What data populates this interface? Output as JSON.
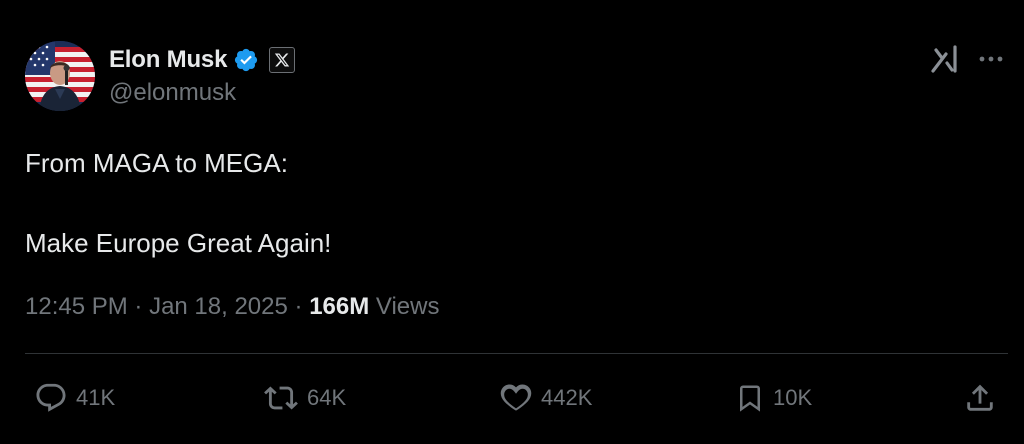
{
  "author": {
    "display_name": "Elon Musk",
    "handle": "@elonmusk",
    "verified": true
  },
  "tweet": {
    "line1": "From MAGA to MEGA:",
    "line2": "Make Europe Great Again!"
  },
  "meta": {
    "time": "12:45 PM",
    "sep1": " · ",
    "date": "Jan 18, 2025",
    "sep2": " · ",
    "views_count": "166M",
    "views_label": " Views"
  },
  "actions": {
    "replies": "41K",
    "reposts": "64K",
    "likes": "442K",
    "bookmarks": "10K"
  },
  "colors": {
    "background": "#000000",
    "text": "#e7e9ea",
    "muted": "#71767b",
    "verified_blue": "#1d9bf0",
    "divider": "#2f3336"
  },
  "icons": {
    "verified": "verified-badge-icon",
    "affiliation": "x-logo-icon",
    "grok": "grok-icon",
    "more": "more-icon",
    "reply": "reply-icon",
    "repost": "repost-icon",
    "like": "heart-icon",
    "bookmark": "bookmark-icon",
    "share": "share-icon"
  }
}
